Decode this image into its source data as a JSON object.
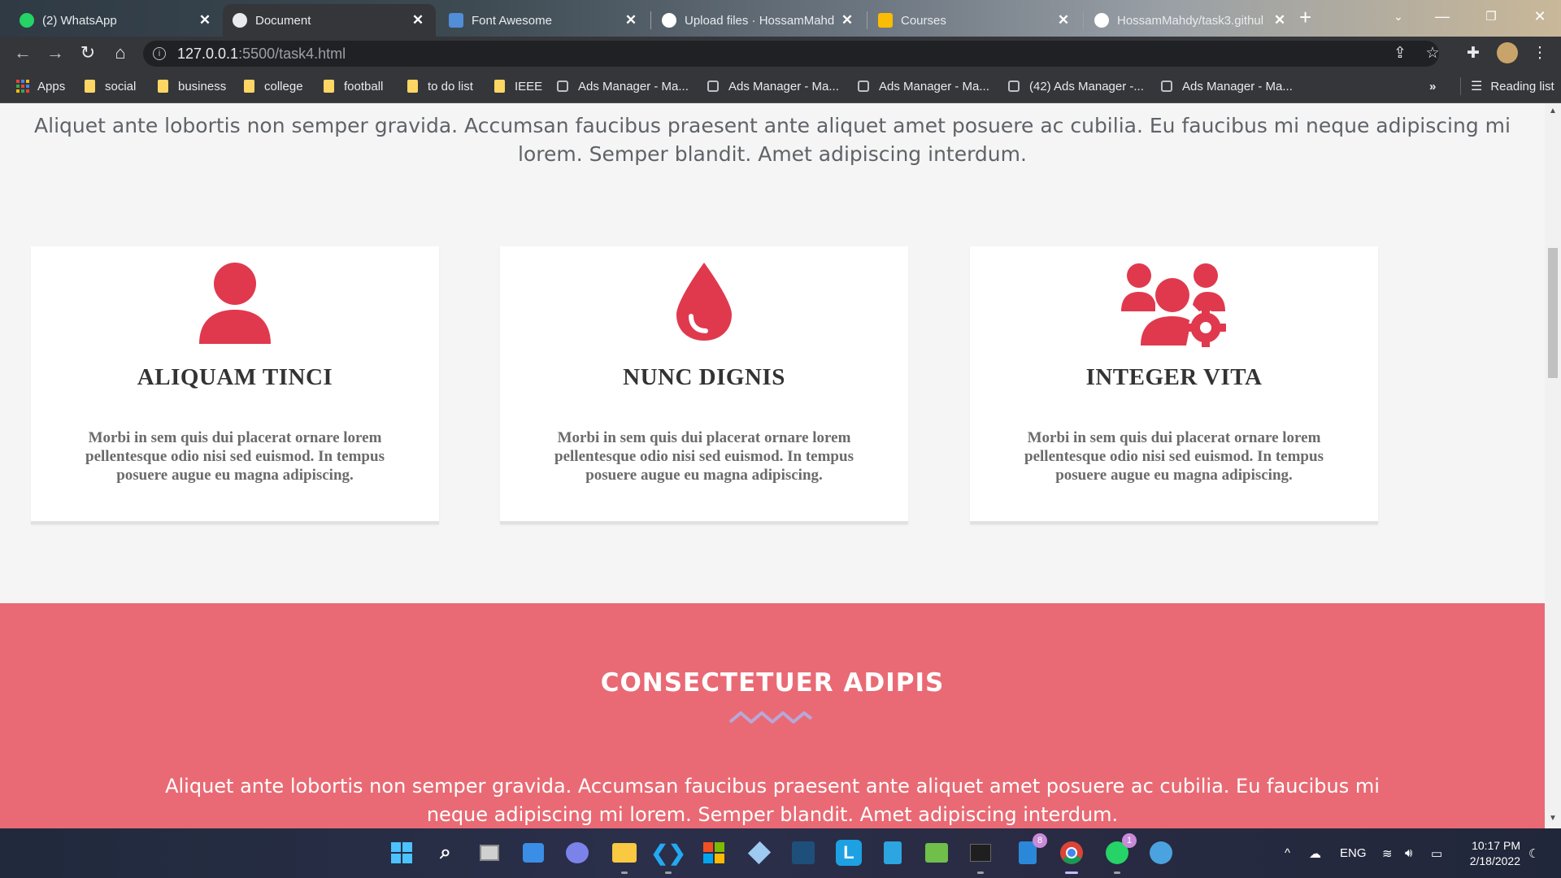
{
  "browser": {
    "tabs": [
      {
        "title": "(2) WhatsApp",
        "icon": "whatsapp-icon",
        "color": "#25d366",
        "active": false
      },
      {
        "title": "Document",
        "icon": "globe-icon",
        "color": "#e8eaed",
        "active": true
      },
      {
        "title": "Font Awesome",
        "icon": "font-awesome-icon",
        "color": "#528dd7",
        "active": false
      },
      {
        "title": "Upload files · HossamMahd",
        "icon": "github-icon",
        "color": "#ffffff",
        "active": false
      },
      {
        "title": "Courses",
        "icon": "classroom-icon",
        "color": "#fbbc04",
        "active": false
      },
      {
        "title": "HossamMahdy/task3.githul",
        "icon": "github-icon",
        "color": "#ffffff",
        "active": false
      }
    ],
    "close_glyph": "✕",
    "new_tab_glyph": "+",
    "url_host": "127.0.0.1",
    "url_path": ":5500/task4.html",
    "bookmarks": [
      {
        "label": "Apps",
        "type": "apps"
      },
      {
        "label": "social",
        "type": "folder"
      },
      {
        "label": "business",
        "type": "folder"
      },
      {
        "label": "college",
        "type": "folder"
      },
      {
        "label": "football",
        "type": "folder"
      },
      {
        "label": "to do list",
        "type": "folder"
      },
      {
        "label": "IEEE",
        "type": "folder"
      },
      {
        "label": "Ads Manager - Ma...",
        "type": "page"
      },
      {
        "label": "Ads Manager - Ma...",
        "type": "page"
      },
      {
        "label": "Ads Manager - Ma...",
        "type": "page"
      },
      {
        "label": "(42) Ads Manager -...",
        "type": "page"
      },
      {
        "label": "Ads Manager - Ma...",
        "type": "page"
      }
    ],
    "more_bookmarks": "»",
    "reading_list": "Reading list"
  },
  "page": {
    "intro_text": "Aliquet ante lobortis non semper gravida. Accumsan faucibus praesent ante aliquet amet posuere ac cubilia. Eu faucibus mi neque adipiscing mi lorem. Semper blandit. Amet adipiscing interdum.",
    "accent_color": "#e0394e",
    "cards": [
      {
        "icon": "user-icon",
        "title": "ALIQUAM TINCI",
        "text": "Morbi in sem quis dui placerat ornare lorem pellentesque odio nisi sed euismod. In tempus posuere augue eu magna adipiscing."
      },
      {
        "icon": "droplet-icon",
        "title": "NUNC DIGNIS",
        "text": "Morbi in sem quis dui placerat ornare lorem pellentesque odio nisi sed euismod. In tempus posuere augue eu magna adipiscing."
      },
      {
        "icon": "users-gear-icon",
        "title": "INTEGER VITA",
        "text": "Morbi in sem quis dui placerat ornare lorem pellentesque odio nisi sed euismod. In tempus posuere augue eu magna adipiscing."
      }
    ],
    "band": {
      "title": "CONSECTETUER ADIPIS",
      "text": "Aliquet ante lobortis non semper gravida. Accumsan faucibus praesent ante aliquet amet posuere ac cubilia. Eu faucibus mi neque adipiscing mi lorem. Semper blandit. Amet adipiscing interdum.",
      "color": "#e96a74"
    }
  },
  "taskbar": {
    "badges": {
      "files": "8",
      "whatsapp": "1"
    },
    "language": "ENG",
    "time": "10:17 PM",
    "date": "2/18/2022"
  }
}
